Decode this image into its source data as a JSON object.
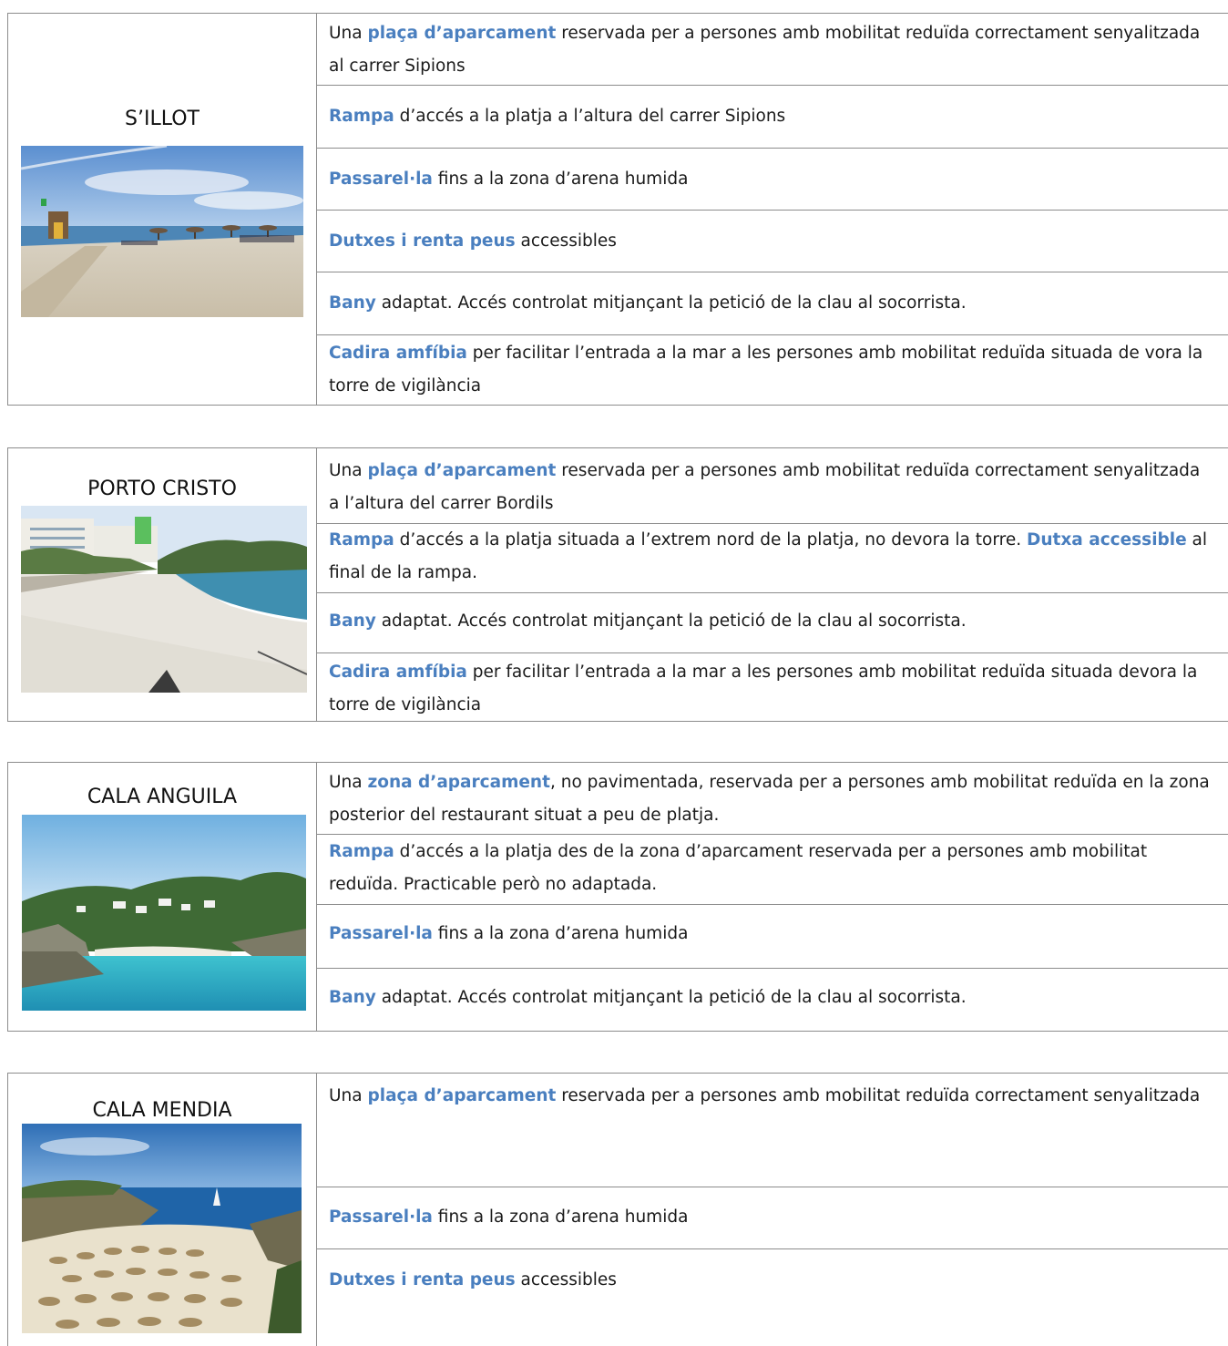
{
  "beaches": [
    {
      "name": "S’ILLOT",
      "rows": [
        {
          "pre": "Una ",
          "bold": "plaça d’aparcament",
          "post": " reservada per a persones amb mobilitat reduïda correctament senyalitzada al carrer Sipions"
        },
        {
          "pre": "",
          "bold": "Rampa",
          "post": " d’accés a la platja a l’altura del carrer Sipions"
        },
        {
          "pre": "",
          "bold": "Passarel·la",
          "post": " fins a la zona d’arena humida"
        },
        {
          "pre": "",
          "bold": "Dutxes i renta peus",
          "post": " accessibles"
        },
        {
          "pre": "",
          "bold": "Bany",
          "post": " adaptat. Accés controlat mitjançant la petició de la clau al socorrista."
        },
        {
          "pre": "",
          "bold": "Cadira amfíbia",
          "post": " per facilitar l’entrada a la mar a les persones amb mobilitat reduïda situada de vora la torre de vigilància"
        }
      ]
    },
    {
      "name": "PORTO CRISTO",
      "rows": [
        {
          "pre": "Una ",
          "bold": "plaça d’aparcament",
          "post": " reservada per a persones amb mobilitat reduïda correctament senyalitzada a l’altura del carrer Bordils"
        },
        {
          "pre": "",
          "bold": "Rampa",
          "post": " d’accés a la platja situada a l’extrem nord de la platja, no devora la torre. ",
          "bold2": "Dutxa accessible",
          "post2": " al final de la rampa."
        },
        {
          "pre": "",
          "bold": "Bany",
          "post": " adaptat. Accés controlat mitjançant la petició de la clau al socorrista."
        },
        {
          "pre": "",
          "bold": "Cadira amfíbia",
          "post": " per facilitar l’entrada a la mar a les persones amb mobilitat reduïda situada devora la torre de vigilància"
        }
      ]
    },
    {
      "name": "CALA ANGUILA",
      "rows": [
        {
          "pre": "Una ",
          "bold": "zona d’aparcament",
          "post": ", no pavimentada, reservada per a persones amb mobilitat reduïda en la zona posterior del restaurant situat a peu de platja."
        },
        {
          "pre": "",
          "bold": "Rampa",
          "post": " d’accés a la platja des de la zona d’aparcament reservada per a persones amb mobilitat reduïda. Practicable però no adaptada."
        },
        {
          "pre": "",
          "bold": "Passarel·la",
          "post": " fins a la zona d’arena humida"
        },
        {
          "pre": "",
          "bold": "Bany",
          "post": " adaptat. Accés controlat mitjançant la petició de la clau al socorrista."
        }
      ]
    },
    {
      "name": "CALA MENDIA",
      "rows": [
        {
          "pre": "Una ",
          "bold": "plaça d’aparcament",
          "post": " reservada per a persones amb mobilitat reduïda correctament senyalitzada"
        },
        {
          "pre": "",
          "bold": "Passarel·la",
          "post": " fins a la zona d’arena humida"
        },
        {
          "pre": "",
          "bold": "Dutxes i renta peus",
          "post": " accessibles"
        }
      ]
    }
  ],
  "colors": {
    "accent": "#4a7fbf",
    "border": "#8c8c8c",
    "text": "#1a1a1a"
  }
}
